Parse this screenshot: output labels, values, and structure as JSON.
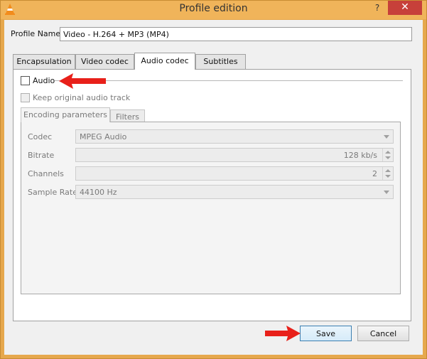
{
  "window": {
    "title": "Profile edition",
    "help_glyph": "?",
    "close_glyph": "✕"
  },
  "profile": {
    "name_label": "Profile Name",
    "name_value": "Video - H.264 + MP3 (MP4)"
  },
  "tabs": [
    {
      "label": "Encapsulation",
      "active": false
    },
    {
      "label": "Video codec",
      "active": false
    },
    {
      "label": "Audio codec",
      "active": true
    },
    {
      "label": "Subtitles",
      "active": false
    }
  ],
  "audio": {
    "enable_label": "Audio",
    "enable_checked": false,
    "keep_label": "Keep original audio track",
    "keep_checked": false,
    "inner_tabs": [
      {
        "label": "Encoding parameters",
        "active": true
      },
      {
        "label": "Filters",
        "active": false
      }
    ],
    "fields": {
      "codec": {
        "label": "Codec",
        "value": "MPEG Audio"
      },
      "bitrate": {
        "label": "Bitrate",
        "value": "128 kb/s"
      },
      "channels": {
        "label": "Channels",
        "value": "2"
      },
      "sample_rate": {
        "label": "Sample Rate",
        "value": "44100 Hz"
      }
    }
  },
  "buttons": {
    "save": "Save",
    "cancel": "Cancel"
  },
  "colors": {
    "title_bar": "#f0b45a",
    "close_button": "#c7403a",
    "annotation_arrow": "#e8201a"
  },
  "icons": {
    "app": "vlc-cone-icon",
    "help": "help-icon",
    "close": "close-icon"
  }
}
